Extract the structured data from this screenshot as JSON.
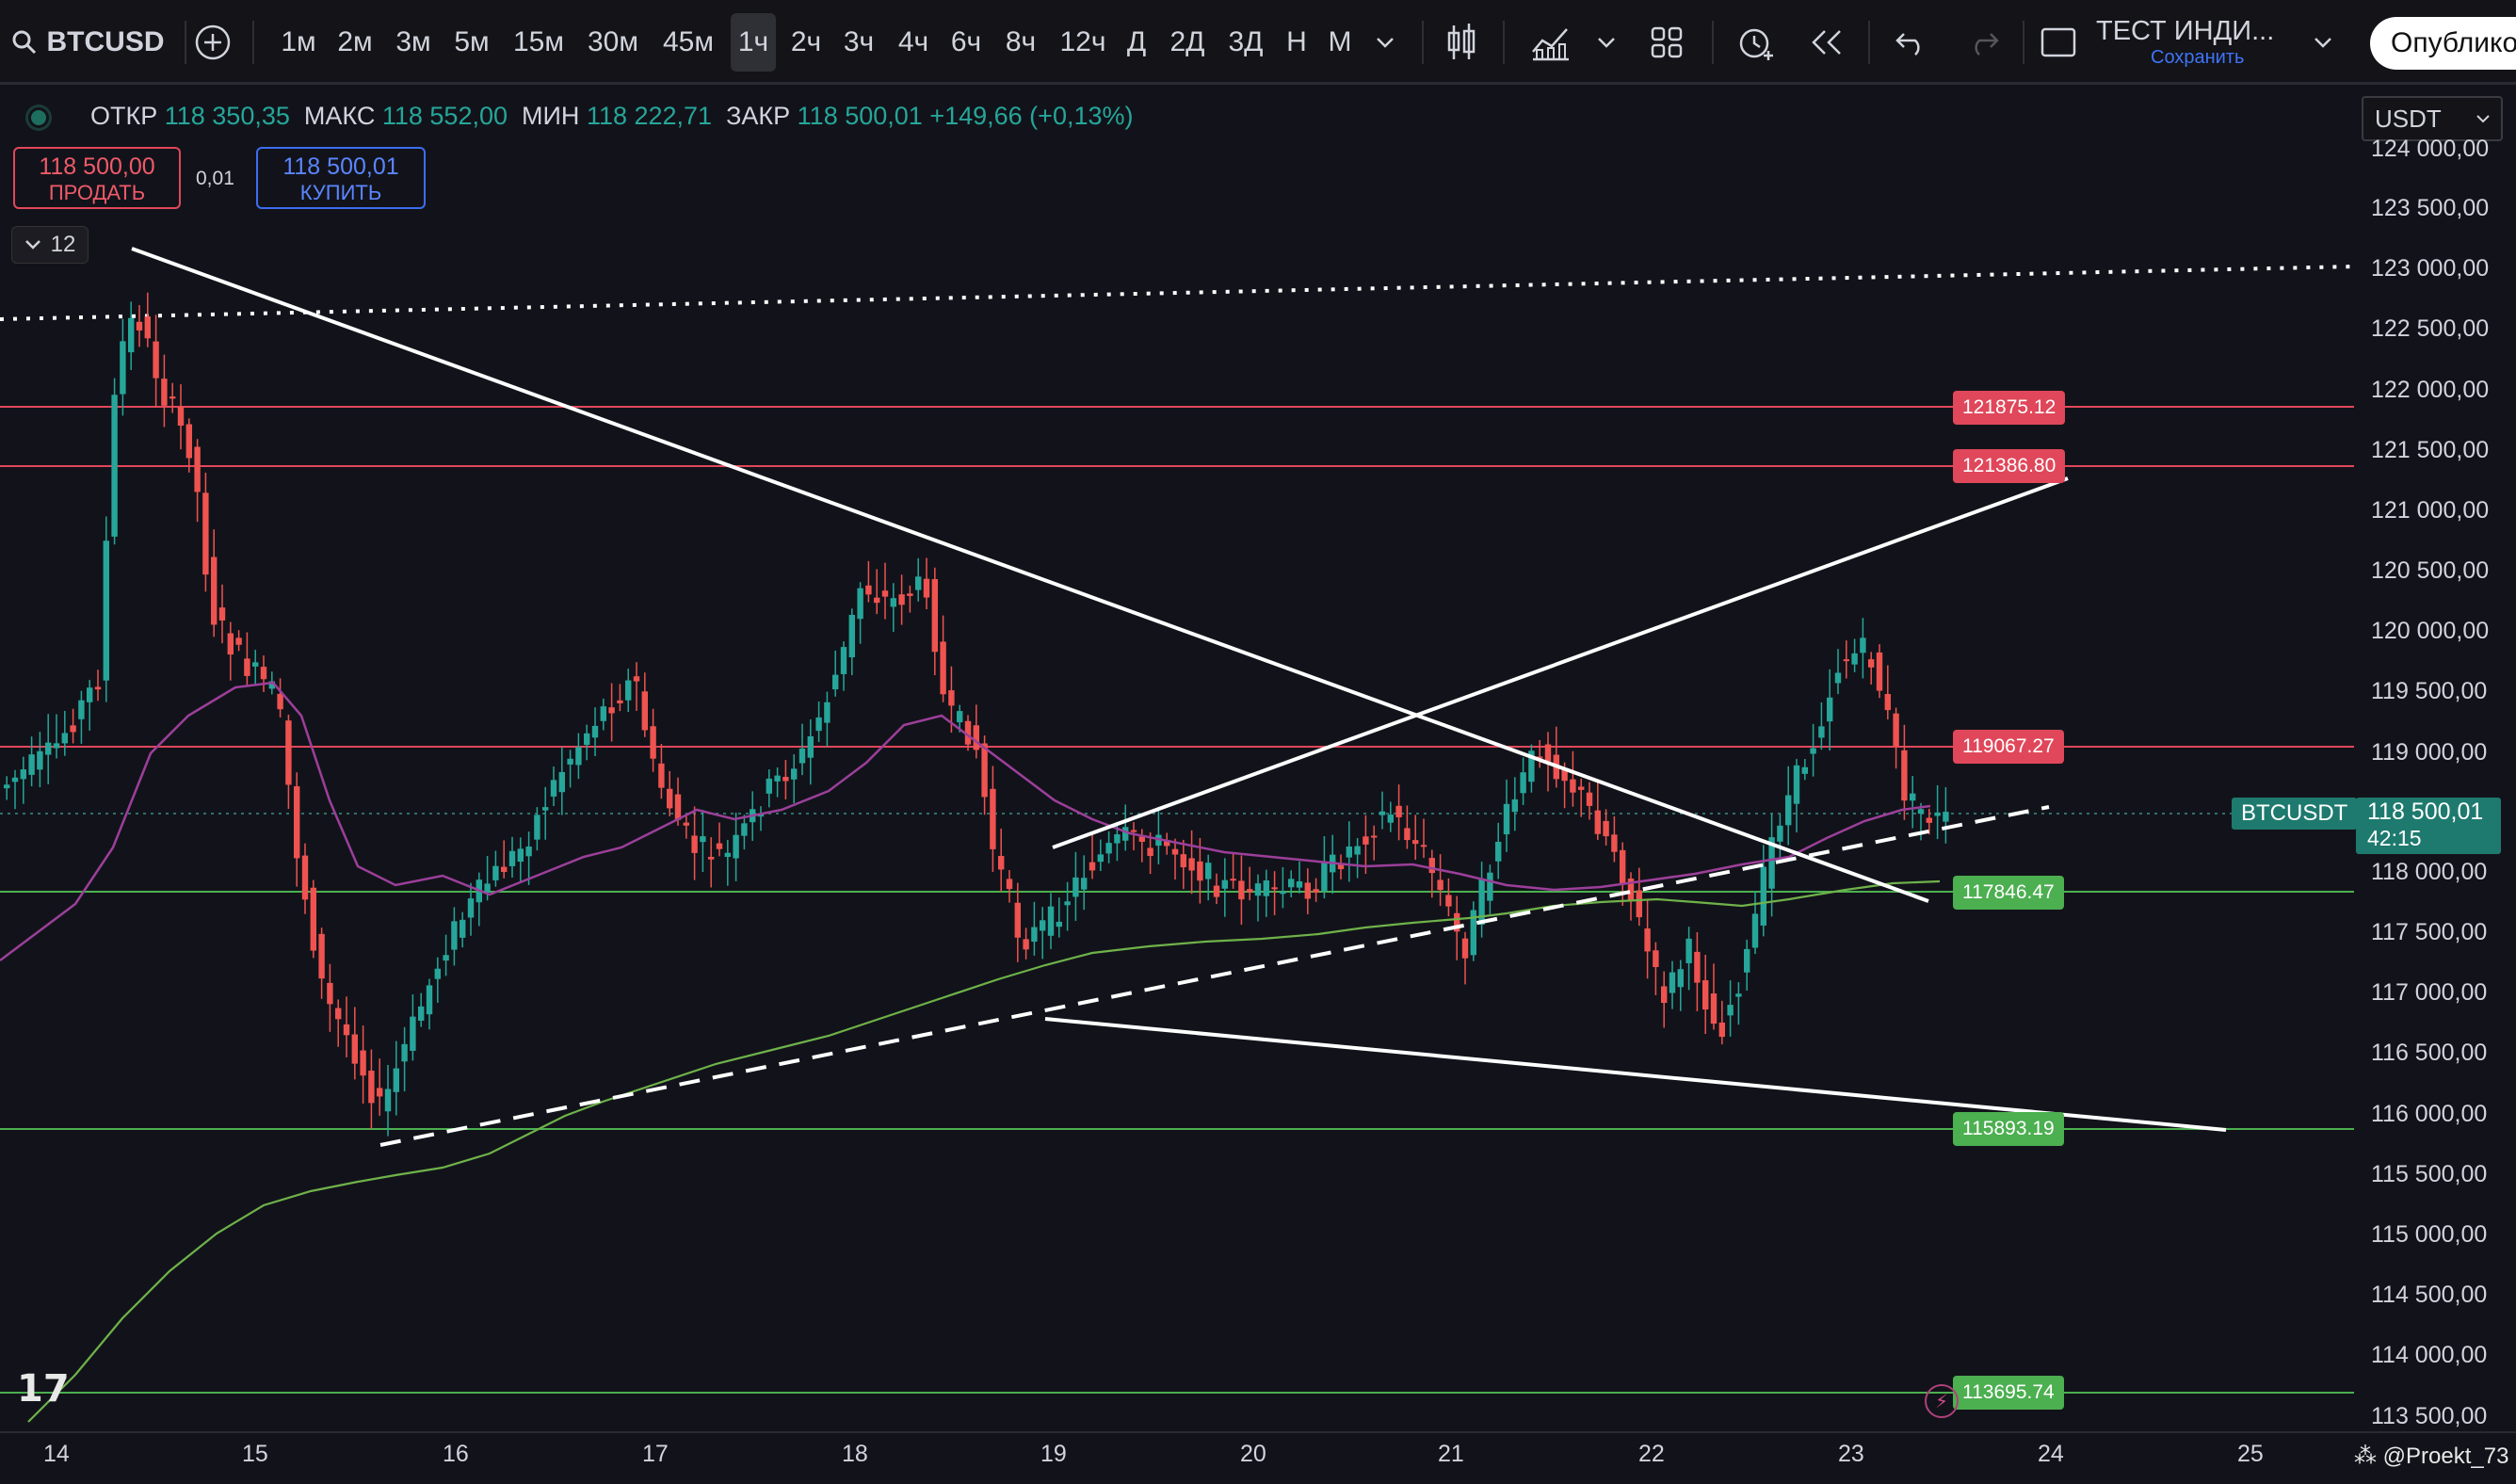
{
  "toolbar": {
    "symbol": "BTCUSD",
    "timeframes": [
      "1м",
      "2м",
      "3м",
      "5м",
      "15м",
      "30м",
      "45м",
      "1ч",
      "2ч",
      "3ч",
      "4ч",
      "6ч",
      "8ч",
      "12ч",
      "Д",
      "2Д",
      "3Д",
      "Н",
      "М"
    ],
    "active_timeframe": "1ч",
    "layout_name": "ТЕСТ ИНДИ...",
    "layout_status": "Сохранить",
    "publish_label": "Опублико"
  },
  "ohlc": {
    "open_label": "ОТКР",
    "open": "118 350,35",
    "high_label": "МАКС",
    "high": "118 552,00",
    "low_label": "МИН",
    "low": "118 222,71",
    "close_label": "ЗАКР",
    "close": "118 500,01",
    "change": "+149,66 (+0,13%)"
  },
  "trade": {
    "sell_price": "118 500,00",
    "sell_label": "ПРОДАТЬ",
    "spread": "0,01",
    "buy_price": "118 500,01",
    "buy_label": "КУПИТЬ"
  },
  "indicator_badge": "12",
  "currency": "USDT",
  "price_axis": {
    "ticks": [
      "124 000,00",
      "123 500,00",
      "123 000,00",
      "122 500,00",
      "122 000,00",
      "121 500,00",
      "121 000,00",
      "120 500,00",
      "120 000,00",
      "119 500,00",
      "119 000,00",
      "118 000,00",
      "117 500,00",
      "117 000,00",
      "116 500,00",
      "116 000,00",
      "115 500,00",
      "115 000,00",
      "114 500,00",
      "114 000,00",
      "113 500,00"
    ],
    "current_symbol": "BTCUSDT",
    "current_price": "118 500,01",
    "countdown": "42:15"
  },
  "time_axis": [
    "14",
    "15",
    "16",
    "17",
    "18",
    "19",
    "20",
    "21",
    "22",
    "23",
    "24",
    "25"
  ],
  "levels": [
    {
      "label": "121875.12",
      "color": "#e0475a"
    },
    {
      "label": "121386.80",
      "color": "#e0475a"
    },
    {
      "label": "119067.27",
      "color": "#e0475a"
    },
    {
      "label": "117846.47",
      "color": "#4caf50"
    },
    {
      "label": "115893.19",
      "color": "#4caf50"
    },
    {
      "label": "113695.74",
      "color": "#4caf50"
    }
  ],
  "watermark": "@Proekt_73",
  "colors": {
    "up": "#26a69a",
    "down": "#ef5350",
    "ma_fast": "#9c3f9a",
    "ma_slow": "#6fb24a"
  }
}
